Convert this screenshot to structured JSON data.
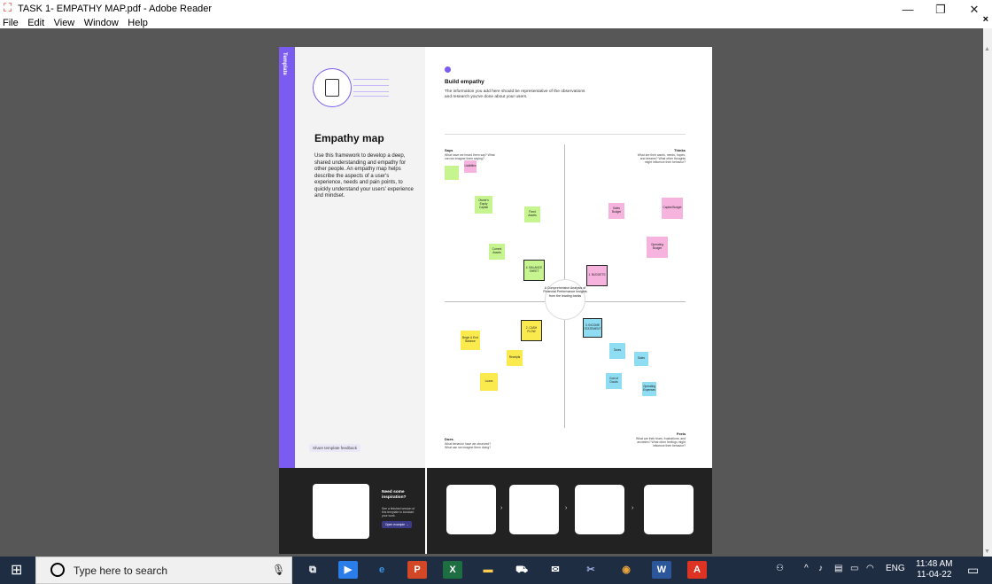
{
  "window": {
    "title": "TASK 1- EMPATHY MAP.pdf - Adobe Reader",
    "minimize": "—",
    "restore": "❐",
    "close": "✕",
    "doc_close": "×"
  },
  "menu": [
    "File",
    "Edit",
    "View",
    "Window",
    "Help"
  ],
  "page": {
    "strip_label": "Template",
    "title": "Empathy map",
    "description": "Use this framework to develop a deep, shared understanding and empathy for other people. An empathy map helps describe the aspects of a user's experience, needs and pain points, to quickly understand your users' experience and mindset.",
    "feedback": "Share template feedback",
    "build_title": "Build empathy",
    "build_sub": "The information you add here should be representative of the observations and research you've done about your users.",
    "center": "A Comprehensive Analysis of Financial Performance Insights from the leading banks",
    "quadrants": {
      "says": "Says",
      "says_sub": "What have we heard them say? What can we imagine them saying?",
      "thinks": "Thinks",
      "thinks_sub": "What are their wants, needs, hopes, and dreams? What other thoughts might influence their behavior?",
      "does": "Does",
      "does_sub": "What behavior have we observed? What can we imagine them doing?",
      "feels": "Feels",
      "feels_sub": "What are their fears, frustrations, and anxieties? What other feelings might influence their behavior?"
    },
    "notes": {
      "liabilities": "Liabilities",
      "owners_equity": "Owner's Equity Capital",
      "fixed_assets": "Fixed Assets",
      "current_assets": "Current Assets",
      "balance_sheet": "4. BALANCE SHEET",
      "sales_budget": "Sales Budget",
      "capital_budget": "Capital Budget",
      "operating_budget": "Operating Budget",
      "budgets": "1. BUDGETS",
      "cash_flow": "2. CASH FLOW",
      "begin_end_balance": "Begin & End Balance",
      "receipts": "Receipts",
      "loans": "Loans",
      "income_statement": "3. INCOME STATEMENT",
      "taxes": "Taxes",
      "sales": "Sales",
      "cost_of_goods": "Cost of Goods",
      "operating_expenses": "Operating Expenses"
    },
    "inspiration_title": "Need some inspiration?",
    "inspiration_desc": "See a finished version of this template to kickstart your work.",
    "inspiration_btn": "Open example →"
  },
  "taskbar": {
    "search_placeholder": "Type here to search",
    "lang": "ENG",
    "time": "11:48 AM",
    "date": "11-04-22"
  }
}
